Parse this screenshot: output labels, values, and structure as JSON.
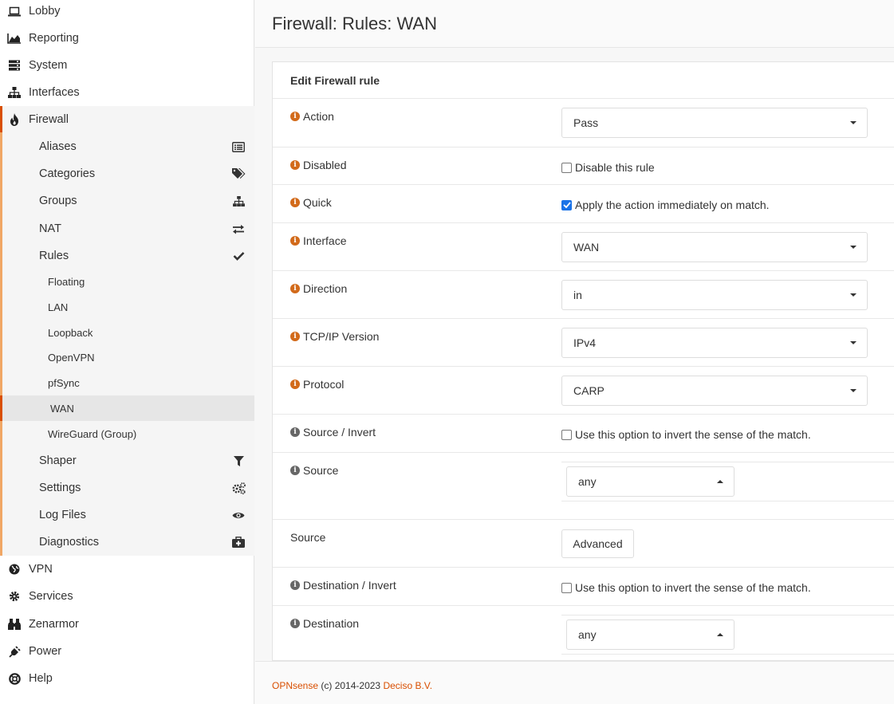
{
  "sidebar": {
    "top_items": [
      {
        "label": "Lobby",
        "icon": "laptop-icon"
      },
      {
        "label": "Reporting",
        "icon": "area-chart-icon"
      },
      {
        "label": "System",
        "icon": "server-icon"
      },
      {
        "label": "Interfaces",
        "icon": "sitemap-icon"
      },
      {
        "label": "Firewall",
        "icon": "fire-icon"
      }
    ],
    "firewall_items": [
      {
        "label": "Aliases",
        "icon": "list-alt-icon"
      },
      {
        "label": "Categories",
        "icon": "tags-icon"
      },
      {
        "label": "Groups",
        "icon": "sitemap-icon"
      },
      {
        "label": "NAT",
        "icon": "exchange-icon"
      },
      {
        "label": "Rules",
        "icon": "check-icon"
      }
    ],
    "rules_items": [
      "Floating",
      "LAN",
      "Loopback",
      "OpenVPN",
      "pfSync",
      "WAN",
      "WireGuard (Group)"
    ],
    "firewall_items_after": [
      {
        "label": "Shaper",
        "icon": "filter-icon"
      },
      {
        "label": "Settings",
        "icon": "cogs-icon"
      },
      {
        "label": "Log Files",
        "icon": "eye-icon"
      },
      {
        "label": "Diagnostics",
        "icon": "medkit-icon"
      }
    ],
    "bottom_items": [
      {
        "label": "VPN",
        "icon": "globe-icon"
      },
      {
        "label": "Services",
        "icon": "cog-icon"
      },
      {
        "label": "Zenarmor",
        "icon": "binoculars-icon"
      },
      {
        "label": "Power",
        "icon": "plug-icon"
      },
      {
        "label": "Help",
        "icon": "life-ring-icon"
      }
    ]
  },
  "header": {
    "title": "Firewall: Rules: WAN"
  },
  "form": {
    "heading": "Edit Firewall rule",
    "action": {
      "label": "Action",
      "value": "Pass"
    },
    "disabled": {
      "label": "Disabled",
      "checkbox_label": "Disable this rule",
      "checked": false
    },
    "quick": {
      "label": "Quick",
      "checkbox_label": "Apply the action immediately on match.",
      "checked": true
    },
    "interface": {
      "label": "Interface",
      "value": "WAN"
    },
    "direction": {
      "label": "Direction",
      "value": "in"
    },
    "tcpip": {
      "label": "TCP/IP Version",
      "value": "IPv4"
    },
    "protocol": {
      "label": "Protocol",
      "value": "CARP"
    },
    "source_invert": {
      "label": "Source / Invert",
      "checkbox_label": "Use this option to invert the sense of the match.",
      "checked": false
    },
    "source": {
      "label": "Source",
      "value": "any"
    },
    "source_adv": {
      "label": "Source",
      "button": "Advanced"
    },
    "dest_invert": {
      "label": "Destination / Invert",
      "checkbox_label": "Use this option to invert the sense of the match.",
      "checked": false
    },
    "destination": {
      "label": "Destination",
      "value": "any"
    }
  },
  "footer": {
    "brand": "OPNsense",
    "copyright": "(c) 2014-2023",
    "company": "Deciso B.V."
  },
  "colors": {
    "accent": "#d94f00",
    "accent_light": "#f0a765",
    "checkbox_on": "#1a73e8"
  }
}
